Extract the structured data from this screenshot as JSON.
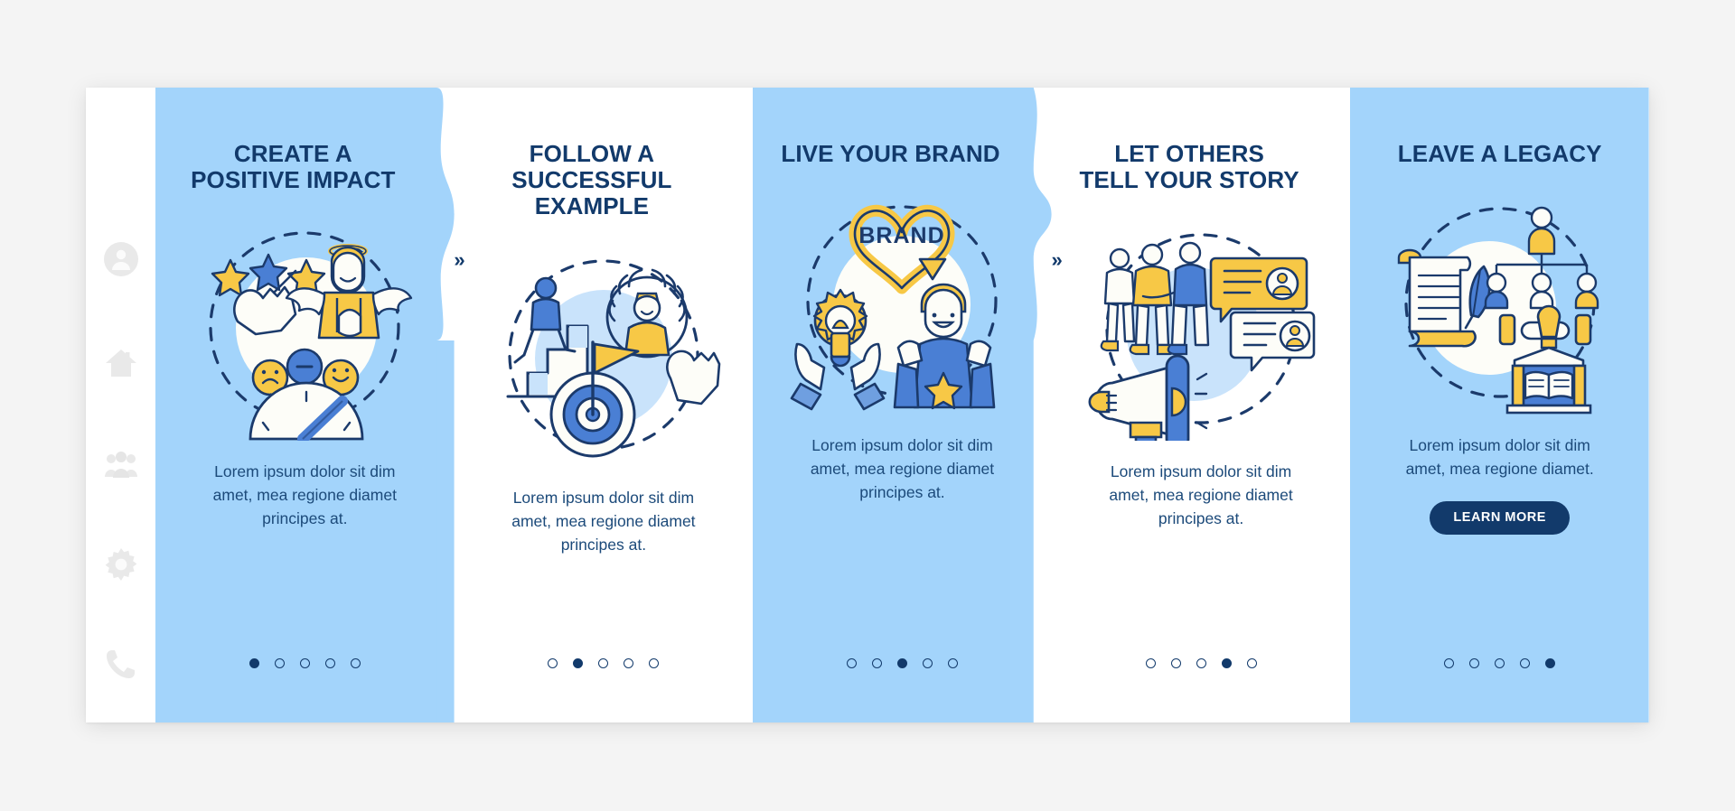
{
  "colors": {
    "page_background": "#f4f4f4",
    "panel_blue": "#a3d4fb",
    "panel_white": "#ffffff",
    "heading_navy": "#123a6b",
    "body_navy": "#1c4a7a",
    "accent_yellow": "#f7c846",
    "accent_blue": "#4a7fd4",
    "cta_background": "#123a6b",
    "cta_text": "#ffffff",
    "sidebar_icon_grey": "#e8e8e8"
  },
  "sidebar": {
    "items": [
      {
        "icon": "user-avatar-icon",
        "label": "Profile"
      },
      {
        "icon": "home-icon",
        "label": "Home"
      },
      {
        "icon": "group-people-icon",
        "label": "Team"
      },
      {
        "icon": "gear-icon",
        "label": "Settings"
      },
      {
        "icon": "phone-icon",
        "label": "Contact"
      }
    ]
  },
  "arrow_glyph": "»",
  "panels": [
    {
      "id": "create-a-positive-impact",
      "theme": "blue",
      "title": "CREATE A\nPOSITIVE IMPACT",
      "body": "Lorem ipsum dolor sit dim amet, mea regione diamet principes at.",
      "illustration": "stars-angel-satisfaction-meter-illustration",
      "has_arrow": true,
      "has_cta": false,
      "dots": {
        "count": 5,
        "active": 1
      }
    },
    {
      "id": "follow-a-successful-example",
      "theme": "white",
      "title": "FOLLOW A\nSUCCESSFUL EXAMPLE",
      "body": "Lorem ipsum dolor sit dim amet, mea regione diamet principes at.",
      "illustration": "stairs-laurel-wreath-target-flag-illustration",
      "has_arrow": true,
      "has_cta": false,
      "dots": {
        "count": 5,
        "active": 2
      }
    },
    {
      "id": "live-your-brand",
      "theme": "blue",
      "title": "LIVE YOUR BRAND",
      "body": "Lorem ipsum dolor sit dim amet, mea regione diamet principes at.",
      "illustration": "brand-heart-lightbulb-hands-person-illustration",
      "illustration_text": "BRAND",
      "has_arrow": true,
      "has_cta": false,
      "dots": {
        "count": 5,
        "active": 3
      }
    },
    {
      "id": "let-others-tell-your-story",
      "theme": "white",
      "title": "LET OTHERS\nTELL YOUR STORY",
      "body": "Lorem ipsum dolor sit dim amet, mea regione diamet principes at.",
      "illustration": "people-megaphone-testimonial-bubbles-illustration",
      "has_arrow": true,
      "has_cta": false,
      "dots": {
        "count": 5,
        "active": 4
      }
    },
    {
      "id": "leave-a-legacy",
      "theme": "blue",
      "title": "LEAVE A LEGACY",
      "body": "Lorem ipsum dolor sit dim amet, mea regione diamet.",
      "illustration": "scroll-quill-org-chart-monument-illustration",
      "has_arrow": false,
      "has_cta": true,
      "cta_label": "LEARN MORE",
      "dots": {
        "count": 5,
        "active": 5
      }
    }
  ]
}
